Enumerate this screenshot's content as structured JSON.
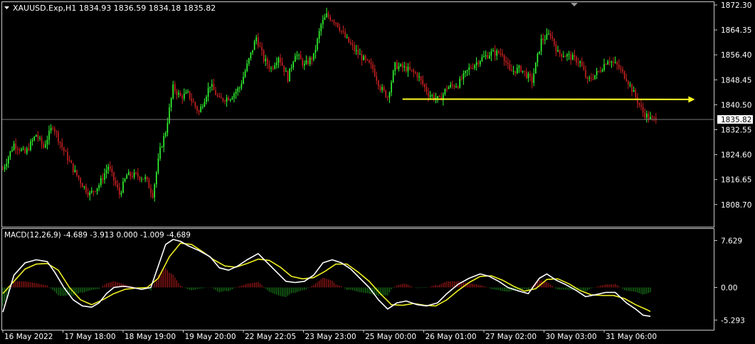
{
  "header": {
    "symbol_line": "XAUUSD.Exp,H1  1834.93 1836.59 1834.18 1835.82",
    "macd_line": "MACD(12,26,9) -4.689 -3.913 0.000 -1.009 -4.689"
  },
  "colors": {
    "background": "#000000",
    "frame": "#c8c8c8",
    "text": "#ffffff",
    "bull": "#33ff33",
    "bear": "#cc2222",
    "trendline": "#ffff22",
    "macd_main": "#ffffff",
    "macd_signal": "#eeee22",
    "hist_pos": "#a01818",
    "hist_neg": "#1a7a1a",
    "current_price_line": "#8a8a8a"
  },
  "chart_data": [
    {
      "type": "candlestick",
      "price_axis": {
        "range": [
          1804.8,
          1872.3
        ],
        "ticks": [
          "1872.30",
          "1864.35",
          "1856.40",
          "1848.45",
          "1840.50",
          "1832.55",
          "1824.60",
          "1816.65",
          "1808.70"
        ]
      },
      "current_price": "1835.82",
      "x_labels": [
        "16 May 2022",
        "17 May 18:00",
        "18 May 19:00",
        "19 May 20:00",
        "22 May 22:05",
        "23 May 23:00",
        "25 May 00:00",
        "26 May 01:00",
        "27 May 02:00",
        "30 May 03:00",
        "31 May 06:00"
      ],
      "close_path": [
        [
          0,
          1820
        ],
        [
          6,
          1828
        ],
        [
          12,
          1825
        ],
        [
          18,
          1831
        ],
        [
          22,
          1827
        ],
        [
          27,
          1834
        ],
        [
          32,
          1827
        ],
        [
          38,
          1820
        ],
        [
          43,
          1815
        ],
        [
          47,
          1812
        ],
        [
          52,
          1815
        ],
        [
          57,
          1821
        ],
        [
          63,
          1812
        ],
        [
          67,
          1818
        ],
        [
          72,
          1818
        ],
        [
          77,
          1817
        ],
        [
          81,
          1812
        ],
        [
          85,
          1826
        ],
        [
          88,
          1832
        ],
        [
          92,
          1846
        ],
        [
          96,
          1843
        ],
        [
          100,
          1844
        ],
        [
          106,
          1838
        ],
        [
          112,
          1847
        ],
        [
          117,
          1842
        ],
        [
          123,
          1843
        ],
        [
          128,
          1846
        ],
        [
          132,
          1853
        ],
        [
          137,
          1862
        ],
        [
          141,
          1855
        ],
        [
          145,
          1852
        ],
        [
          149,
          1856
        ],
        [
          154,
          1849
        ],
        [
          158,
          1857
        ],
        [
          163,
          1853
        ],
        [
          168,
          1856
        ],
        [
          172,
          1866
        ],
        [
          175,
          1869
        ],
        [
          180,
          1867
        ],
        [
          185,
          1862
        ],
        [
          190,
          1858
        ],
        [
          195,
          1855
        ],
        [
          200,
          1852
        ],
        [
          204,
          1846
        ],
        [
          208,
          1843
        ],
        [
          212,
          1853
        ],
        [
          218,
          1852
        ],
        [
          224,
          1850
        ],
        [
          230,
          1844
        ],
        [
          236,
          1842
        ],
        [
          240,
          1846
        ],
        [
          246,
          1847
        ],
        [
          252,
          1852
        ],
        [
          258,
          1855
        ],
        [
          264,
          1857
        ],
        [
          270,
          1857
        ],
        [
          274,
          1851
        ],
        [
          280,
          1852
        ],
        [
          286,
          1848
        ],
        [
          291,
          1861
        ],
        [
          296,
          1863
        ],
        [
          300,
          1857
        ],
        [
          306,
          1856
        ],
        [
          312,
          1854
        ],
        [
          316,
          1848
        ],
        [
          322,
          1851
        ],
        [
          327,
          1855
        ],
        [
          332,
          1853
        ],
        [
          337,
          1849
        ],
        [
          342,
          1843
        ],
        [
          346,
          1838
        ],
        [
          350,
          1836
        ],
        [
          353,
          1835.82
        ]
      ],
      "trendline": [
        [
          216,
          1842.3
        ],
        [
          374,
          1842.2
        ]
      ]
    },
    {
      "type": "line",
      "name": "MACD(12,26,9)",
      "y_axis": {
        "range": [
          -6.3,
          8.6
        ],
        "ticks": [
          "7.629",
          "0.00",
          "-5.293"
        ]
      },
      "macd": [
        [
          0,
          -4.0
        ],
        [
          6,
          2.0
        ],
        [
          12,
          4.0
        ],
        [
          18,
          4.5
        ],
        [
          24,
          4.2
        ],
        [
          28,
          2.5
        ],
        [
          33,
          0.0
        ],
        [
          38,
          -2.0
        ],
        [
          43,
          -3.0
        ],
        [
          48,
          -3.2
        ],
        [
          52,
          -2.5
        ],
        [
          56,
          -1.0
        ],
        [
          60,
          0.0
        ],
        [
          65,
          0.2
        ],
        [
          70,
          0.0
        ],
        [
          75,
          -0.3
        ],
        [
          80,
          0.0
        ],
        [
          84,
          3.5
        ],
        [
          88,
          7.0
        ],
        [
          92,
          7.8
        ],
        [
          96,
          7.5
        ],
        [
          100,
          6.8
        ],
        [
          106,
          6.0
        ],
        [
          112,
          5.0
        ],
        [
          117,
          3.2
        ],
        [
          122,
          2.8
        ],
        [
          127,
          3.5
        ],
        [
          132,
          4.5
        ],
        [
          138,
          5.5
        ],
        [
          143,
          4.0
        ],
        [
          148,
          2.5
        ],
        [
          153,
          1.0
        ],
        [
          158,
          0.8
        ],
        [
          163,
          1.0
        ],
        [
          168,
          2.0
        ],
        [
          173,
          4.0
        ],
        [
          178,
          4.5
        ],
        [
          183,
          4.0
        ],
        [
          188,
          3.0
        ],
        [
          193,
          1.5
        ],
        [
          198,
          0.0
        ],
        [
          203,
          -2.0
        ],
        [
          208,
          -3.5
        ],
        [
          213,
          -2.5
        ],
        [
          218,
          -2.2
        ],
        [
          224,
          -2.8
        ],
        [
          229,
          -3.0
        ],
        [
          235,
          -2.5
        ],
        [
          240,
          -1.0
        ],
        [
          246,
          0.5
        ],
        [
          252,
          1.5
        ],
        [
          258,
          2.2
        ],
        [
          263,
          1.8
        ],
        [
          268,
          1.0
        ],
        [
          273,
          0.0
        ],
        [
          278,
          -0.5
        ],
        [
          284,
          -1.0
        ],
        [
          290,
          1.5
        ],
        [
          294,
          2.2
        ],
        [
          299,
          1.2
        ],
        [
          304,
          0.5
        ],
        [
          310,
          -0.5
        ],
        [
          315,
          -1.5
        ],
        [
          320,
          -1.2
        ],
        [
          326,
          -0.8
        ],
        [
          331,
          -0.8
        ],
        [
          337,
          -2.5
        ],
        [
          342,
          -3.5
        ],
        [
          346,
          -4.5
        ],
        [
          350,
          -4.689
        ]
      ],
      "signal": [
        [
          0,
          -1.0
        ],
        [
          6,
          1.0
        ],
        [
          12,
          3.0
        ],
        [
          18,
          3.8
        ],
        [
          24,
          3.9
        ],
        [
          30,
          2.8
        ],
        [
          36,
          0.0
        ],
        [
          42,
          -2.0
        ],
        [
          48,
          -2.8
        ],
        [
          54,
          -2.0
        ],
        [
          60,
          -1.0
        ],
        [
          66,
          -0.3
        ],
        [
          72,
          -0.1
        ],
        [
          78,
          0.0
        ],
        [
          84,
          1.5
        ],
        [
          90,
          5.0
        ],
        [
          96,
          7.2
        ],
        [
          102,
          7.0
        ],
        [
          108,
          5.8
        ],
        [
          114,
          4.5
        ],
        [
          120,
          3.5
        ],
        [
          126,
          3.3
        ],
        [
          132,
          3.9
        ],
        [
          138,
          4.6
        ],
        [
          144,
          4.4
        ],
        [
          150,
          3.3
        ],
        [
          156,
          1.8
        ],
        [
          162,
          1.4
        ],
        [
          168,
          1.6
        ],
        [
          174,
          2.6
        ],
        [
          180,
          3.8
        ],
        [
          186,
          3.8
        ],
        [
          192,
          2.5
        ],
        [
          198,
          1.0
        ],
        [
          204,
          -1.0
        ],
        [
          210,
          -2.8
        ],
        [
          216,
          -2.9
        ],
        [
          222,
          -2.6
        ],
        [
          228,
          -2.9
        ],
        [
          234,
          -3.0
        ],
        [
          240,
          -2.0
        ],
        [
          246,
          -0.5
        ],
        [
          252,
          0.8
        ],
        [
          258,
          1.8
        ],
        [
          264,
          1.9
        ],
        [
          270,
          1.2
        ],
        [
          276,
          0.2
        ],
        [
          282,
          -0.6
        ],
        [
          288,
          -0.2
        ],
        [
          294,
          1.3
        ],
        [
          300,
          1.4
        ],
        [
          306,
          0.6
        ],
        [
          312,
          -0.5
        ],
        [
          318,
          -1.2
        ],
        [
          324,
          -1.3
        ],
        [
          330,
          -1.3
        ],
        [
          336,
          -1.8
        ],
        [
          342,
          -2.8
        ],
        [
          348,
          -3.6
        ],
        [
          350,
          -3.913
        ]
      ]
    }
  ]
}
